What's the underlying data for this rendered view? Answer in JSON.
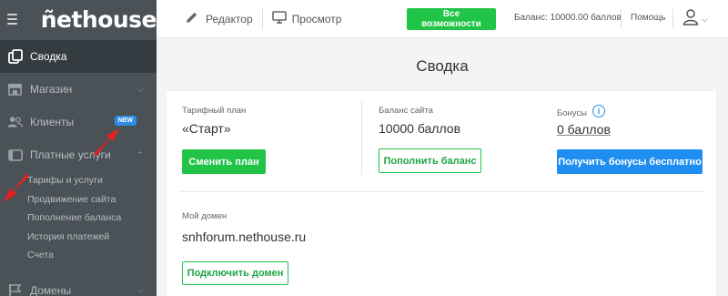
{
  "sidebar": {
    "logo": "ñethouse",
    "items": [
      {
        "label": "Сводка"
      },
      {
        "label": "Магазин"
      },
      {
        "label": "Клиенты",
        "badge": "NEW"
      },
      {
        "label": "Платные услуги"
      },
      {
        "label": "Домены"
      }
    ],
    "sub_items": [
      {
        "label": "Тарифы и услуги"
      },
      {
        "label": "Продвижение сайта"
      },
      {
        "label": "Пополнение баланса"
      },
      {
        "label": "История платежей"
      },
      {
        "label": "Счета"
      }
    ]
  },
  "topbar": {
    "editor_label": "Редактор",
    "preview_label": "Просмотр",
    "features_button": "Все возможности",
    "balance": "Баланс: 10000.00 баллов",
    "help": "Помощь"
  },
  "main": {
    "title": "Сводка",
    "plan": {
      "label": "Тарифный план",
      "value": "«Старт»",
      "button": "Сменить план"
    },
    "site_balance": {
      "label": "Баланс сайта",
      "value": "10000 баллов",
      "button": "Пополнить баланс"
    },
    "bonuses": {
      "label": "Бонусы",
      "value": "0 баллов",
      "button": "Получить бонусы бесплатно"
    },
    "domain": {
      "label": "Мой домен",
      "value": "snhforum.nethouse.ru",
      "button": "Подключить домен"
    }
  },
  "colors": {
    "accent_green": "#21c447",
    "accent_blue": "#1e8ef0",
    "sidebar_bg": "#4a5257",
    "annotation_red": "#e8201a"
  }
}
